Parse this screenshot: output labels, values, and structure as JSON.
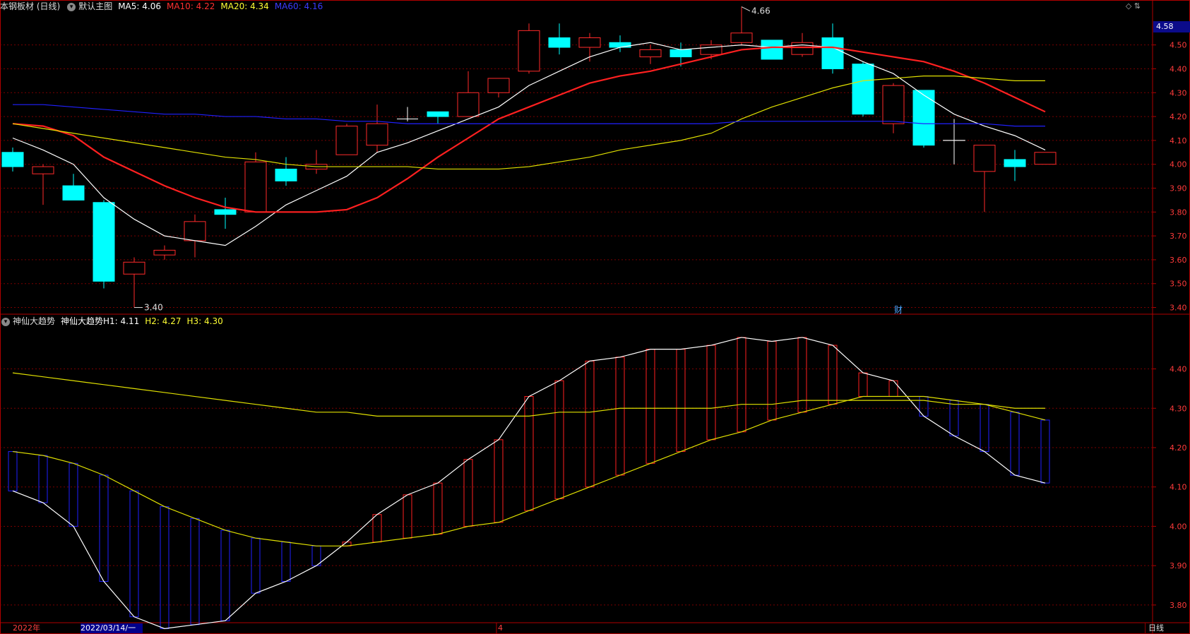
{
  "header_main": {
    "title": "本钢板材 (日线)",
    "chart_name": "默认主图",
    "ma5": "MA5: 4.06",
    "ma10": "MA10: 4.22",
    "ma20": "MA20: 4.34",
    "ma60": "MA60: 4.16"
  },
  "header_ind": {
    "name": "神仙大趋势",
    "h1": "神仙大趋势H1: 4.11",
    "h2": "H2: 4.27",
    "h3": "H3: 4.30"
  },
  "price_badge": "4.58",
  "top_icons": "◇ ⇅",
  "period_label": "日线",
  "x_labels": {
    "year": "2022年",
    "cursor_date": "2022/03/14/一",
    "month": "4"
  },
  "colors": {
    "up": "#ff2a2a",
    "down": "#00ffff",
    "ma5": "#ffffff",
    "ma10": "#ff2020",
    "ma20": "#e0e000",
    "ma60": "#2020ff",
    "grid": "#7a0000",
    "axis": "#b00000",
    "h_rise": "#ff2020",
    "h_fall": "#2020ff",
    "h1": "#ffffff",
    "h2": "#e0e000",
    "h3": "#e0e000"
  },
  "chart_data": [
    {
      "type": "candlestick",
      "title": "本钢板材 (日线)",
      "y_ticks": [
        4.5,
        4.4,
        4.3,
        4.2,
        4.1,
        4.0,
        3.9,
        3.8,
        3.7,
        3.6,
        3.5,
        3.4
      ],
      "ylim": [
        3.375,
        4.635
      ],
      "high_label": "4.66",
      "low_label": "3.40",
      "event_marker": "财",
      "candles": [
        {
          "o": 4.05,
          "h": 4.07,
          "l": 3.97,
          "c": 3.99
        },
        {
          "o": 3.96,
          "h": 4.0,
          "l": 3.83,
          "c": 3.99
        },
        {
          "o": 3.91,
          "h": 3.96,
          "l": 3.85,
          "c": 3.85
        },
        {
          "o": 3.84,
          "h": 3.85,
          "l": 3.48,
          "c": 3.51
        },
        {
          "o": 3.54,
          "h": 3.61,
          "l": 3.4,
          "c": 3.59
        },
        {
          "o": 3.62,
          "h": 3.66,
          "l": 3.6,
          "c": 3.64
        },
        {
          "o": 3.68,
          "h": 3.79,
          "l": 3.61,
          "c": 3.76
        },
        {
          "o": 3.81,
          "h": 3.86,
          "l": 3.73,
          "c": 3.79
        },
        {
          "o": 3.8,
          "h": 4.05,
          "l": 3.8,
          "c": 4.01
        },
        {
          "o": 3.98,
          "h": 4.03,
          "l": 3.91,
          "c": 3.93
        },
        {
          "o": 3.98,
          "h": 4.06,
          "l": 3.96,
          "c": 4.0
        },
        {
          "o": 4.04,
          "h": 4.17,
          "l": 4.04,
          "c": 4.16
        },
        {
          "o": 4.08,
          "h": 4.25,
          "l": 4.05,
          "c": 4.17
        },
        {
          "o": 4.19,
          "h": 4.24,
          "l": 4.18,
          "c": 4.19
        },
        {
          "o": 4.22,
          "h": 4.22,
          "l": 4.17,
          "c": 4.2
        },
        {
          "o": 4.2,
          "h": 4.39,
          "l": 4.2,
          "c": 4.3
        },
        {
          "o": 4.3,
          "h": 4.36,
          "l": 4.28,
          "c": 4.36
        },
        {
          "o": 4.39,
          "h": 4.59,
          "l": 4.38,
          "c": 4.56
        },
        {
          "o": 4.53,
          "h": 4.59,
          "l": 4.46,
          "c": 4.49
        },
        {
          "o": 4.49,
          "h": 4.55,
          "l": 4.43,
          "c": 4.53
        },
        {
          "o": 4.51,
          "h": 4.54,
          "l": 4.47,
          "c": 4.49
        },
        {
          "o": 4.45,
          "h": 4.5,
          "l": 4.42,
          "c": 4.48
        },
        {
          "o": 4.48,
          "h": 4.51,
          "l": 4.41,
          "c": 4.45
        },
        {
          "o": 4.46,
          "h": 4.52,
          "l": 4.44,
          "c": 4.5
        },
        {
          "o": 4.51,
          "h": 4.66,
          "l": 4.5,
          "c": 4.55
        },
        {
          "o": 4.52,
          "h": 4.52,
          "l": 4.44,
          "c": 4.44
        },
        {
          "o": 4.46,
          "h": 4.55,
          "l": 4.45,
          "c": 4.51
        },
        {
          "o": 4.53,
          "h": 4.59,
          "l": 4.38,
          "c": 4.4
        },
        {
          "o": 4.42,
          "h": 4.43,
          "l": 4.2,
          "c": 4.21
        },
        {
          "o": 4.17,
          "h": 4.34,
          "l": 4.13,
          "c": 4.33
        },
        {
          "o": 4.31,
          "h": 4.31,
          "l": 4.07,
          "c": 4.08
        },
        {
          "o": 4.1,
          "h": 4.19,
          "l": 4.0,
          "c": 4.1
        },
        {
          "o": 3.97,
          "h": 4.08,
          "l": 3.8,
          "c": 4.08
        },
        {
          "o": 4.02,
          "h": 4.06,
          "l": 3.93,
          "c": 3.99
        },
        {
          "o": 4.0,
          "h": 4.05,
          "l": 4.0,
          "c": 4.05
        }
      ],
      "series": [
        {
          "name": "MA5",
          "color": "#ffffff",
          "values": [
            4.11,
            4.06,
            4.0,
            3.86,
            3.77,
            3.7,
            3.68,
            3.66,
            3.74,
            3.83,
            3.89,
            3.95,
            4.05,
            4.09,
            4.14,
            4.19,
            4.24,
            4.33,
            4.39,
            4.45,
            4.49,
            4.51,
            4.48,
            4.49,
            4.5,
            4.49,
            4.5,
            4.49,
            4.43,
            4.38,
            4.29,
            4.21,
            4.16,
            4.12,
            4.06
          ]
        },
        {
          "name": "MA10",
          "color": "#ff2020",
          "values": [
            4.17,
            4.16,
            4.12,
            4.03,
            3.97,
            3.91,
            3.86,
            3.82,
            3.8,
            3.8,
            3.8,
            3.81,
            3.86,
            3.94,
            4.03,
            4.11,
            4.19,
            4.24,
            4.29,
            4.34,
            4.37,
            4.39,
            4.42,
            4.45,
            4.48,
            4.49,
            4.49,
            4.49,
            4.47,
            4.45,
            4.43,
            4.39,
            4.34,
            4.28,
            4.22
          ]
        },
        {
          "name": "MA20",
          "color": "#e0e000",
          "values": [
            4.17,
            4.15,
            4.13,
            4.11,
            4.09,
            4.07,
            4.05,
            4.03,
            4.02,
            4.0,
            3.99,
            3.99,
            3.99,
            3.99,
            3.98,
            3.98,
            3.98,
            3.99,
            4.01,
            4.03,
            4.06,
            4.08,
            4.1,
            4.13,
            4.19,
            4.24,
            4.28,
            4.32,
            4.35,
            4.36,
            4.37,
            4.37,
            4.36,
            4.35,
            4.35
          ]
        },
        {
          "name": "MA60",
          "color": "#2020ff",
          "values": [
            4.25,
            4.25,
            4.24,
            4.23,
            4.22,
            4.21,
            4.21,
            4.2,
            4.2,
            4.19,
            4.19,
            4.18,
            4.18,
            4.17,
            4.17,
            4.17,
            4.17,
            4.17,
            4.17,
            4.17,
            4.17,
            4.17,
            4.17,
            4.17,
            4.18,
            4.18,
            4.18,
            4.18,
            4.18,
            4.18,
            4.17,
            4.17,
            4.17,
            4.16,
            4.16
          ]
        }
      ]
    },
    {
      "type": "bar",
      "title": "神仙大趋势",
      "y_ticks": [
        4.4,
        4.3,
        4.2,
        4.1,
        4.0,
        3.9,
        3.8
      ],
      "ylim": [
        3.755,
        4.505
      ],
      "series": [
        {
          "name": "H1",
          "color": "#ffffff",
          "values": [
            4.09,
            4.06,
            4.0,
            3.86,
            3.77,
            3.74,
            3.75,
            3.76,
            3.83,
            3.86,
            3.9,
            3.96,
            4.03,
            4.08,
            4.11,
            4.17,
            4.22,
            4.33,
            4.37,
            4.42,
            4.43,
            4.45,
            4.45,
            4.46,
            4.48,
            4.47,
            4.48,
            4.46,
            4.39,
            4.37,
            4.28,
            4.23,
            4.19,
            4.13,
            4.11
          ]
        },
        {
          "name": "H2",
          "color": "#e0e000",
          "values": [
            4.19,
            4.18,
            4.16,
            4.13,
            4.09,
            4.05,
            4.02,
            3.99,
            3.97,
            3.96,
            3.95,
            3.95,
            3.96,
            3.97,
            3.98,
            4.0,
            4.01,
            4.04,
            4.07,
            4.1,
            4.13,
            4.16,
            4.19,
            4.22,
            4.24,
            4.27,
            4.29,
            4.31,
            4.33,
            4.33,
            4.33,
            4.32,
            4.31,
            4.29,
            4.27
          ]
        },
        {
          "name": "H3",
          "color": "#e0e000",
          "values": [
            4.39,
            4.38,
            4.37,
            4.36,
            4.35,
            4.34,
            4.33,
            4.32,
            4.31,
            4.3,
            4.29,
            4.29,
            4.28,
            4.28,
            4.28,
            4.28,
            4.28,
            4.28,
            4.29,
            4.29,
            4.3,
            4.3,
            4.3,
            4.3,
            4.31,
            4.31,
            4.32,
            4.32,
            4.32,
            4.32,
            4.32,
            4.31,
            4.31,
            4.3,
            4.3
          ]
        }
      ]
    }
  ]
}
